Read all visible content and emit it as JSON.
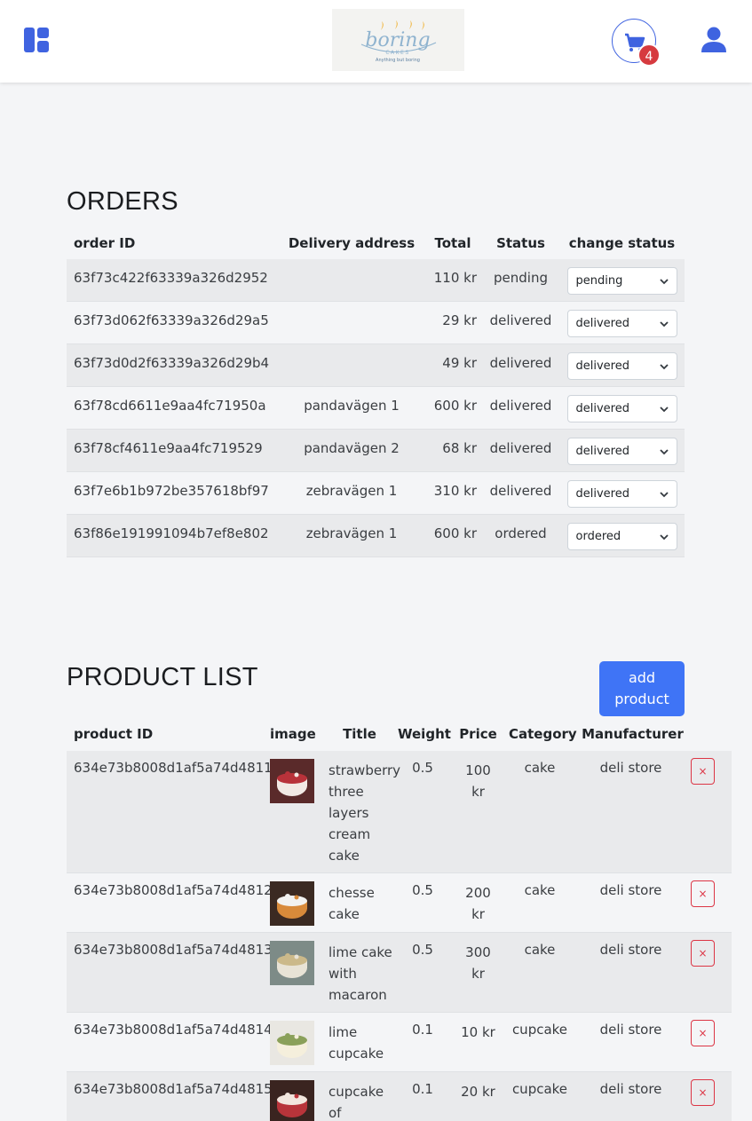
{
  "header": {
    "menu_icon": "dashboard-icon",
    "logo": {
      "text": "boring",
      "sub": "CAKES",
      "tagline": "Anything but boring"
    },
    "cart_icon": "cart-icon",
    "cart_count": "4",
    "user_icon": "user-icon"
  },
  "orders": {
    "title": "ORDERS",
    "columns": {
      "id": "order ID",
      "address": "Delivery address",
      "total": "Total",
      "status": "Status",
      "change": "change status"
    },
    "rows": [
      {
        "id": "63f73c422f63339a326d2952",
        "address": "",
        "total": "110 kr",
        "status": "pending",
        "select": "pending"
      },
      {
        "id": "63f73d062f63339a326d29a5",
        "address": "",
        "total": "29 kr",
        "status": "delivered",
        "select": "delivered"
      },
      {
        "id": "63f73d0d2f63339a326d29b4",
        "address": "",
        "total": "49 kr",
        "status": "delivered",
        "select": "delivered"
      },
      {
        "id": "63f78cd6611e9aa4fc71950a",
        "address": "pandavägen 1",
        "total": "600 kr",
        "status": "delivered",
        "select": "delivered"
      },
      {
        "id": "63f78cf4611e9aa4fc719529",
        "address": "pandavägen 2",
        "total": "68 kr",
        "status": "delivered",
        "select": "delivered"
      },
      {
        "id": "63f7e6b1b972be357618bf97",
        "address": "zebravägen 1",
        "total": "310 kr",
        "status": "delivered",
        "select": "delivered"
      },
      {
        "id": "63f86e191991094b7ef8e802",
        "address": "zebravägen 1",
        "total": "600 kr",
        "status": "ordered",
        "select": "ordered"
      }
    ]
  },
  "products": {
    "title": "PRODUCT LIST",
    "add_label_1": "add",
    "add_label_2": "product",
    "columns": {
      "id": "product ID",
      "image": "image",
      "title": "Title",
      "weight": "Weight",
      "price": "Price",
      "category": "Category",
      "manufacturer": "Manufacturer"
    },
    "delete_label": "×",
    "rows": [
      {
        "id": "634e73b8008d1af5a74d4811",
        "title": [
          "strawberry",
          "three",
          "layers",
          "cream",
          "cake"
        ],
        "weight": "0.5",
        "price": [
          "100",
          "kr"
        ],
        "category": "cake",
        "manufacturer": "deli store",
        "img_colors": [
          "#5a2a2a",
          "#f2e9e4",
          "#b8323a"
        ]
      },
      {
        "id": "634e73b8008d1af5a74d4812",
        "title": [
          "chesse",
          "cake"
        ],
        "weight": "0.5",
        "price": [
          "200",
          "kr"
        ],
        "category": "cake",
        "manufacturer": "deli store",
        "img_colors": [
          "#3b2a22",
          "#d88a3a",
          "#f2f2f0"
        ]
      },
      {
        "id": "634e73b8008d1af5a74d4813",
        "title": [
          "lime cake",
          "with",
          "macaron"
        ],
        "weight": "0.5",
        "price": [
          "300",
          "kr"
        ],
        "category": "cake",
        "manufacturer": "deli store",
        "img_colors": [
          "#7d8b87",
          "#e8e3d6",
          "#cbb98a"
        ]
      },
      {
        "id": "634e73b8008d1af5a74d4814",
        "title": [
          "lime",
          "cupcake"
        ],
        "weight": "0.1",
        "price": [
          "10 kr"
        ],
        "category": "cupcake",
        "manufacturer": "deli store",
        "img_colors": [
          "#e9e7e2",
          "#f5efdc",
          "#8aa05a"
        ]
      },
      {
        "id": "634e73b8008d1af5a74d4815",
        "title": [
          "cupcake",
          "of"
        ],
        "weight": "0.1",
        "price": [
          "20 kr"
        ],
        "category": "cupcake",
        "manufacturer": "deli store",
        "img_colors": [
          "#3a2420",
          "#b8343a",
          "#f2e6de"
        ]
      }
    ]
  }
}
